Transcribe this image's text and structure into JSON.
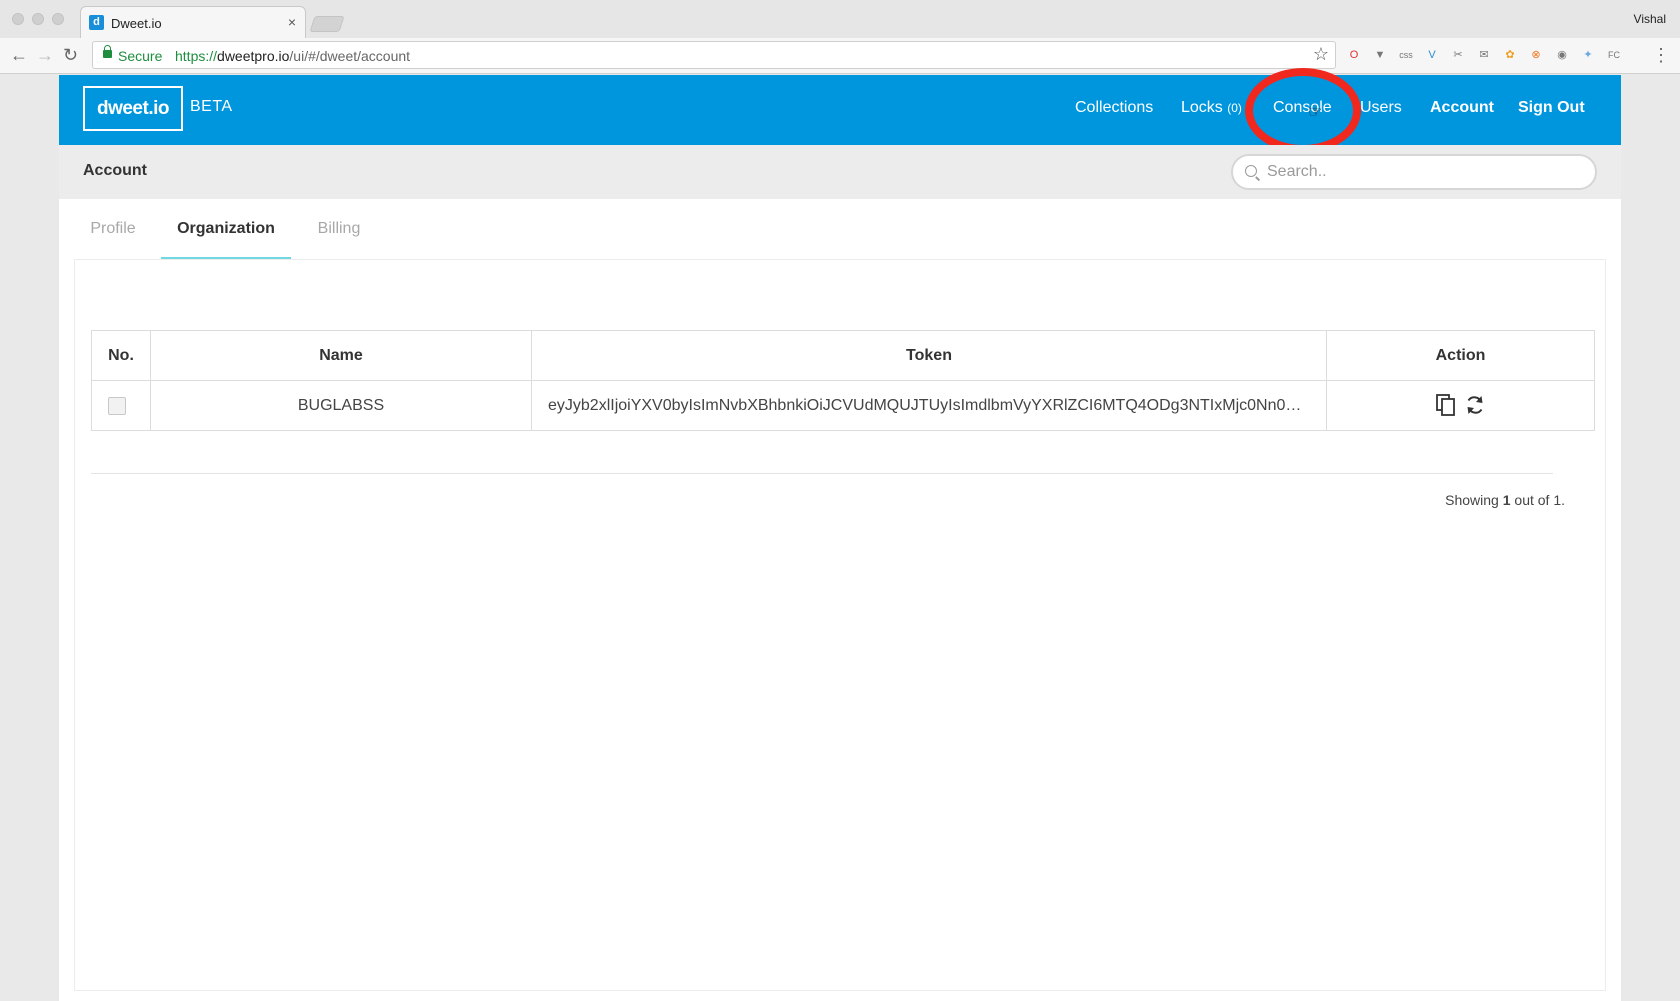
{
  "browser": {
    "tab_title": "Dweet.io",
    "tab_favicon_letter": "d",
    "tab_close": "×",
    "profile_name": "Vishal",
    "secure_label": "Secure",
    "url_scheme": "https://",
    "url_host": "dweetpro.io",
    "url_path": "/ui/#/dweet/account",
    "extensions": [
      "opera-icon",
      "pocket-icon",
      "css-icon",
      "v-icon",
      "scissors-icon",
      "mail-icon",
      "color-wheel-icon",
      "close-circle-icon",
      "ghostery-icon",
      "feather-icon",
      "fc-icon"
    ]
  },
  "header": {
    "logo": "dweet.io",
    "badge": "BETA",
    "nav": {
      "collections": "Collections",
      "locks": "Locks",
      "locks_count": "(0)",
      "console": "Console",
      "users": "Users",
      "account": "Account",
      "sign_out": "Sign Out"
    },
    "brand_color": "#0096de",
    "highlight_color": "#f0281e"
  },
  "subheader": {
    "title": "Account",
    "search_placeholder": "Search.."
  },
  "tabs": [
    {
      "label": "Profile",
      "active": false
    },
    {
      "label": "Organization",
      "active": true
    },
    {
      "label": "Billing",
      "active": false
    }
  ],
  "table": {
    "columns": [
      "No.",
      "Name",
      "Token",
      "Action"
    ],
    "rows": [
      {
        "name": "BUGLABSS",
        "token": "eyJyb2xlIjoiYXV0byIsImNvbXBhbnkiOiJCVUdMQUJTUyIsImdlbmVyYXRlZCI6MTQ4ODg3NTIxMjc0Nn0=…",
        "actions": [
          "copy-icon",
          "refresh-icon"
        ]
      }
    ]
  },
  "footer": {
    "showing_prefix": "Showing ",
    "showing_count": "1",
    "showing_suffix": " out of 1."
  }
}
